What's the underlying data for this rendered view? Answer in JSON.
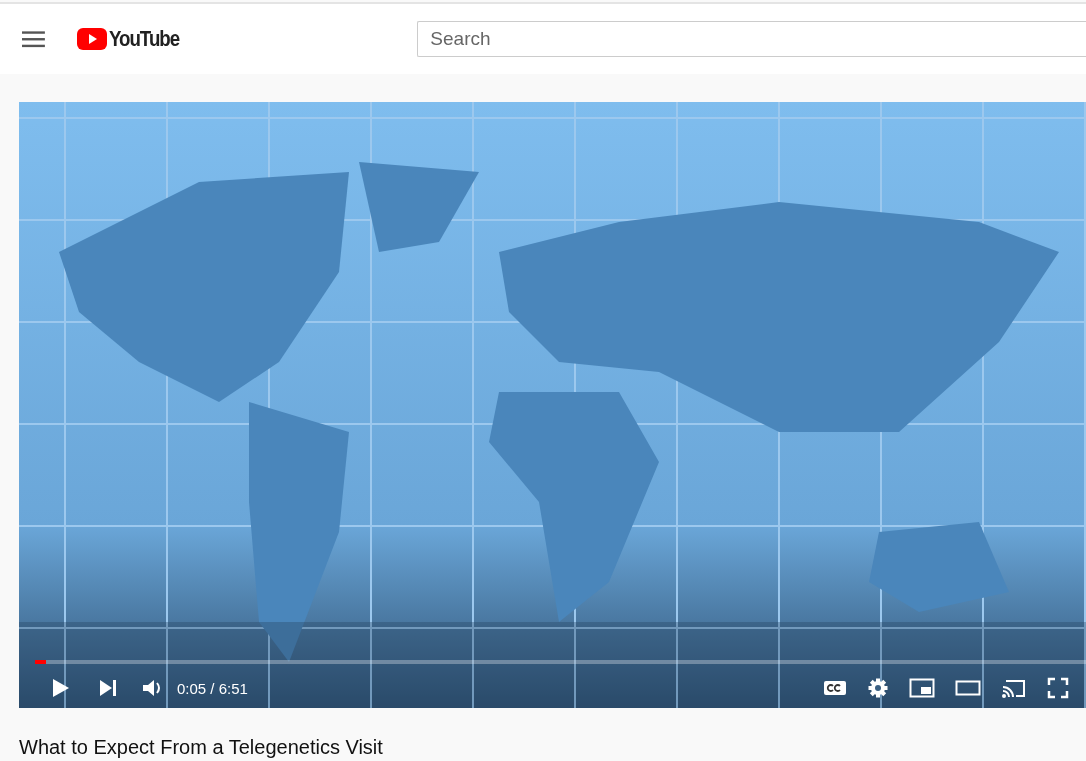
{
  "header": {
    "logo": "YouTube",
    "search": {
      "placeholder": "Search"
    }
  },
  "player": {
    "progress": {
      "level": 0.01
    },
    "time": "0:05 / 6:51"
  },
  "video_title": "What to Expect From a Telegenetics Visit"
}
